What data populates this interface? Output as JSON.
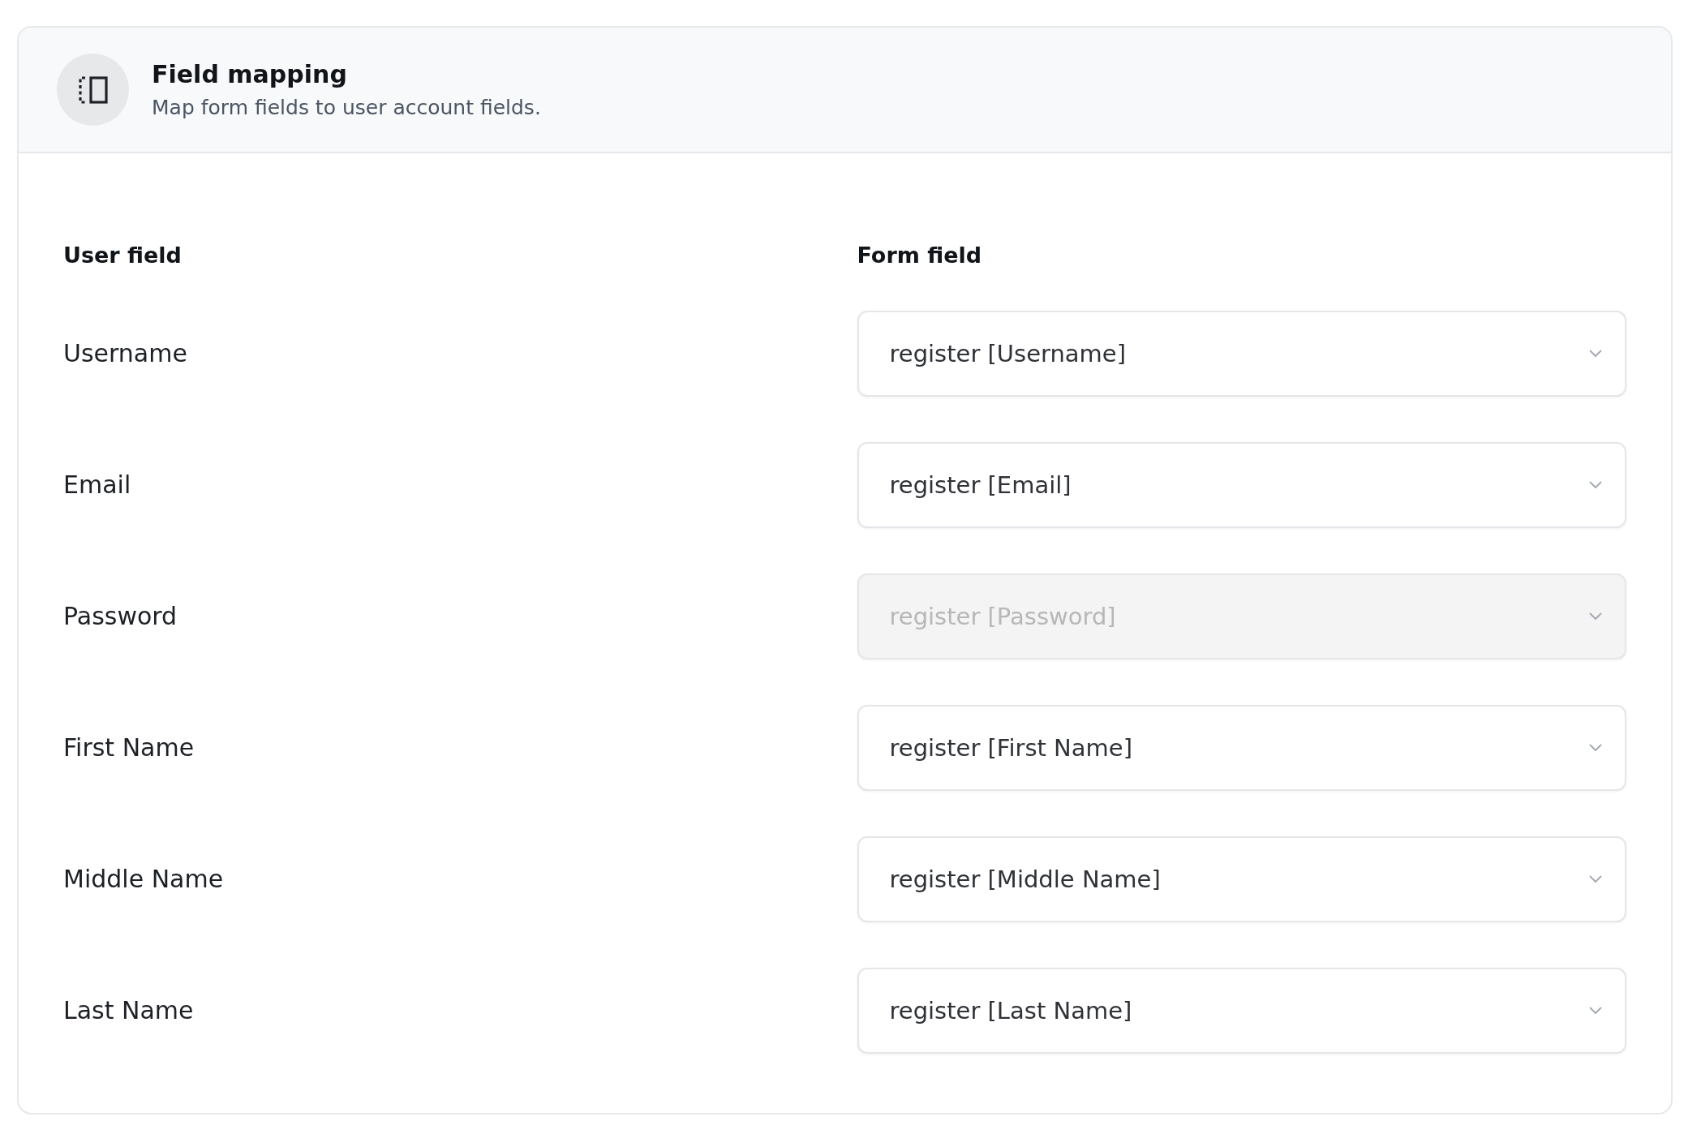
{
  "header": {
    "title": "Field mapping",
    "subtitle": "Map form fields to user account fields."
  },
  "columns": [
    "User field",
    "Form field"
  ],
  "rows": [
    {
      "user_field": "Username",
      "form_field": "register [Username]",
      "disabled": false
    },
    {
      "user_field": "Email",
      "form_field": "register [Email]",
      "disabled": false
    },
    {
      "user_field": "Password",
      "form_field": "register [Password]",
      "disabled": true
    },
    {
      "user_field": "First Name",
      "form_field": "register [First Name]",
      "disabled": false
    },
    {
      "user_field": "Middle Name",
      "form_field": "register [Middle Name]",
      "disabled": false
    },
    {
      "user_field": "Last Name",
      "form_field": "register [Last Name]",
      "disabled": false
    }
  ]
}
